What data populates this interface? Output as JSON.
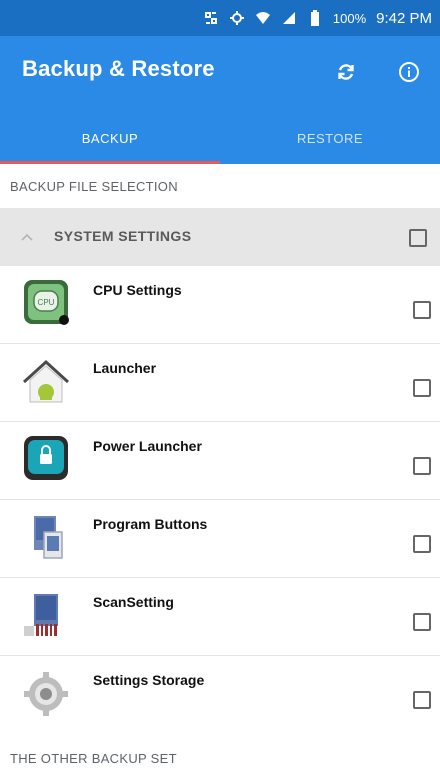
{
  "status_bar": {
    "battery_text": "100%",
    "time": "9:42 PM",
    "icons": [
      "nfc-icon",
      "sync-icon",
      "wifi-icon",
      "signal-icon",
      "battery-icon"
    ]
  },
  "app_bar": {
    "title": "Backup & Restore",
    "actions": [
      "refresh-icon",
      "info-icon"
    ],
    "background": "#2b8ae6"
  },
  "tabs": [
    {
      "label": "BACKUP",
      "selected": true
    },
    {
      "label": "RESTORE",
      "selected": false
    }
  ],
  "sections": {
    "file_selection": "BACKUP FILE SELECTION",
    "other_set": "THE OTHER BACKUP SET"
  },
  "group": {
    "label": "SYSTEM SETTINGS",
    "expanded": true,
    "checked": false
  },
  "items": [
    {
      "label": "CPU Settings",
      "icon": "cpu-settings-icon",
      "checked": false
    },
    {
      "label": "Launcher",
      "icon": "launcher-icon",
      "checked": false
    },
    {
      "label": "Power Launcher",
      "icon": "power-launcher-icon",
      "checked": false
    },
    {
      "label": "Program Buttons",
      "icon": "program-buttons-icon",
      "checked": false
    },
    {
      "label": "ScanSetting",
      "icon": "scan-setting-icon",
      "checked": false
    },
    {
      "label": "Settings Storage",
      "icon": "settings-storage-icon",
      "checked": false
    }
  ],
  "colors": {
    "status_bar": "#1a6fc2",
    "primary": "#2b8ae6",
    "tab_indicator": "#e85a5a",
    "group_bg": "#e6e6e6"
  }
}
